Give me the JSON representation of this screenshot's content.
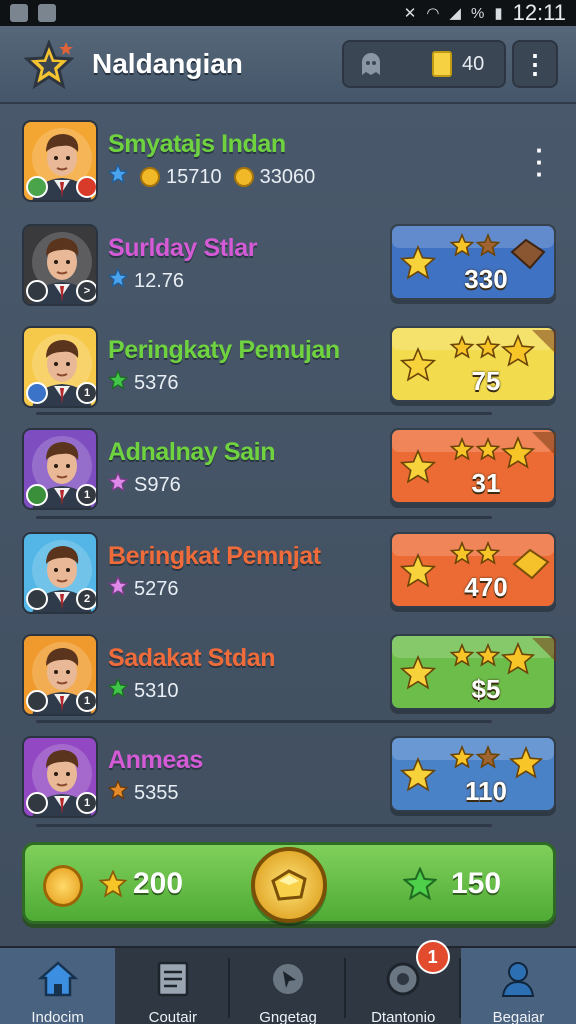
{
  "status_bar": {
    "time": "12:11",
    "battery_pct": "%"
  },
  "header": {
    "title": "Naldangian",
    "currency_count": "40",
    "menu_label": "⋮"
  },
  "rows": [
    {
      "name": "Smyatajs Indan",
      "name_color": "#6fd33f",
      "stat_icon": "blue-star",
      "stat": "",
      "coin_a": "15710",
      "coin_b": "33060",
      "badge": "",
      "avatar_bg": "#f4a632",
      "card": null
    },
    {
      "name": "Surlday Stlar",
      "name_color": "#d45ad6",
      "stat_icon": "blue-star",
      "stat": "12.76",
      "badge": ">",
      "avatar_bg": "#3a3a3d",
      "card": {
        "value": "330",
        "color": "#3f72c2",
        "extra": "brown-gem"
      }
    },
    {
      "name": "Peringkaty Pemujan",
      "name_color": "#6fd33f",
      "stat_icon": "green-star",
      "stat": "5376",
      "badge": "1",
      "avatar_bg": "#f7c94a",
      "card": {
        "value": "75",
        "color": "#f2dc4d",
        "extra": "ribbon"
      }
    },
    {
      "name": "Adnalnay Sain",
      "name_color": "#6fd33f",
      "stat_icon": "pink-star",
      "stat": "S976",
      "badge": "1",
      "avatar_bg": "#7e4ec0",
      "card": {
        "value": "31",
        "color": "#ec6b34",
        "extra": "ribbon"
      }
    },
    {
      "name": "Beringkat Pemnjat",
      "name_color": "#ef6b3a",
      "stat_icon": "pink-star",
      "stat": "5276",
      "badge": "2",
      "avatar_bg": "#53b6e6",
      "card": {
        "value": "470",
        "color": "#ec6b34",
        "extra": "gold-gem"
      }
    },
    {
      "name": "Sadakat Stdan",
      "name_color": "#ef6b3a",
      "stat_icon": "green-star",
      "stat": "5310",
      "badge": "1",
      "avatar_bg": "#f09a2d",
      "card": {
        "value": "$5",
        "color": "#6cbd4a",
        "extra": "ribbon"
      }
    },
    {
      "name": "Anmeas",
      "name_color": "#d45ad6",
      "stat_icon": "gear-coin",
      "stat": "5355",
      "badge": "1",
      "avatar_bg": "#9248c2",
      "card": {
        "value": "110",
        "color": "#4a82c8",
        "extra": "fox"
      }
    }
  ],
  "reward_bar": {
    "left_value": "200",
    "right_value": "150"
  },
  "bottom_nav": [
    {
      "label": "Indocim",
      "icon": "home-icon",
      "active": true
    },
    {
      "label": "Coutair",
      "icon": "document-icon",
      "active": false
    },
    {
      "label": "Gngetag",
      "icon": "cursor-icon",
      "active": false
    },
    {
      "label": "Dtantonio",
      "icon": "target-icon",
      "active": false,
      "notification": "1"
    },
    {
      "label": "Begaiar",
      "icon": "profile-icon",
      "active": true
    }
  ]
}
